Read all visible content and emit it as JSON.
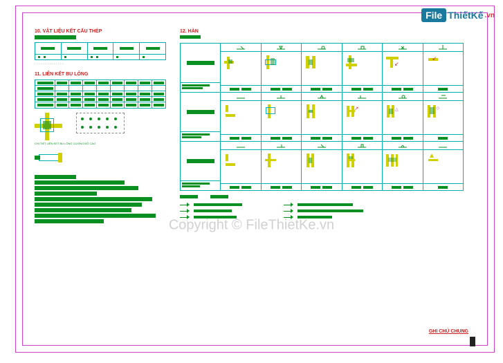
{
  "logo": {
    "box": "File",
    "text1": "ThiếtKế",
    "text2": ".vn"
  },
  "watermark": "Copyright © FileThietKe.vn",
  "section10": {
    "title": "10. VẬT LIỆU KẾT CẤU THÉP",
    "cols": [
      "",
      "",
      "",
      "",
      ""
    ],
    "note_line": "·  ·  ·  ·  ·  ·  ·  ·  ·  ·  ·  ·  ·  ·"
  },
  "section11": {
    "title": "11. LIÊN KẾT BU LÔNG",
    "rows": [
      [
        "",
        "",
        "",
        "",
        "",
        "",
        "",
        "",
        ""
      ],
      [
        "",
        "",
        "",
        "",
        "",
        "",
        "",
        "",
        ""
      ],
      [
        "",
        "",
        "",
        "",
        "",
        "",
        "",
        "",
        ""
      ],
      [
        "",
        "",
        "",
        "",
        "",
        "",
        "",
        "",
        ""
      ],
      [
        "",
        "",
        "",
        "",
        "",
        "",
        "",
        "",
        ""
      ]
    ],
    "sketch_caption": "CHI TIẾT LIÊN KẾT BU LÔNG CƯỜNG ĐỘ CAO",
    "notes": [
      "",
      "",
      "",
      "",
      "",
      "",
      "",
      "",
      ""
    ]
  },
  "section12": {
    "title": "12. HÀN",
    "blocks": [
      {
        "head_symbols": [
          "s1",
          "s2",
          "s3",
          "s4",
          "s5",
          "s6"
        ],
        "cells": 6,
        "foot": [
          [
            "a",
            "b"
          ],
          [
            "a",
            "b"
          ],
          [
            "a",
            "b"
          ],
          [
            "a",
            "b"
          ],
          [
            "a",
            "b"
          ],
          [
            "a"
          ]
        ]
      },
      {
        "head_symbols": [
          "s1",
          "s2",
          "s3",
          "s4",
          "s5",
          "s6"
        ],
        "cells": 6,
        "foot": [
          [
            "a",
            "b"
          ],
          [
            "a",
            "b"
          ],
          [
            "a",
            "b"
          ],
          [
            "a",
            "b"
          ],
          [
            "a",
            "b"
          ],
          [
            "a"
          ]
        ]
      },
      {
        "head_symbols": [
          "s1",
          "s2",
          "s3",
          "s4",
          "s5",
          "s6"
        ],
        "cells": 6,
        "foot": [
          [
            "a",
            "b"
          ],
          [
            "a",
            "b"
          ],
          [
            "a",
            "b"
          ],
          [
            "a",
            "b"
          ],
          [
            "a",
            "b"
          ],
          [
            "a"
          ]
        ]
      }
    ],
    "below": {
      "left_lines": [
        "",
        "",
        ""
      ],
      "right_lines": [
        "",
        "",
        ""
      ]
    },
    "bottom_bars": [
      "",
      ""
    ]
  },
  "title_block": {
    "line1": "GHI CHÚ CHUNG",
    "line2": ""
  }
}
